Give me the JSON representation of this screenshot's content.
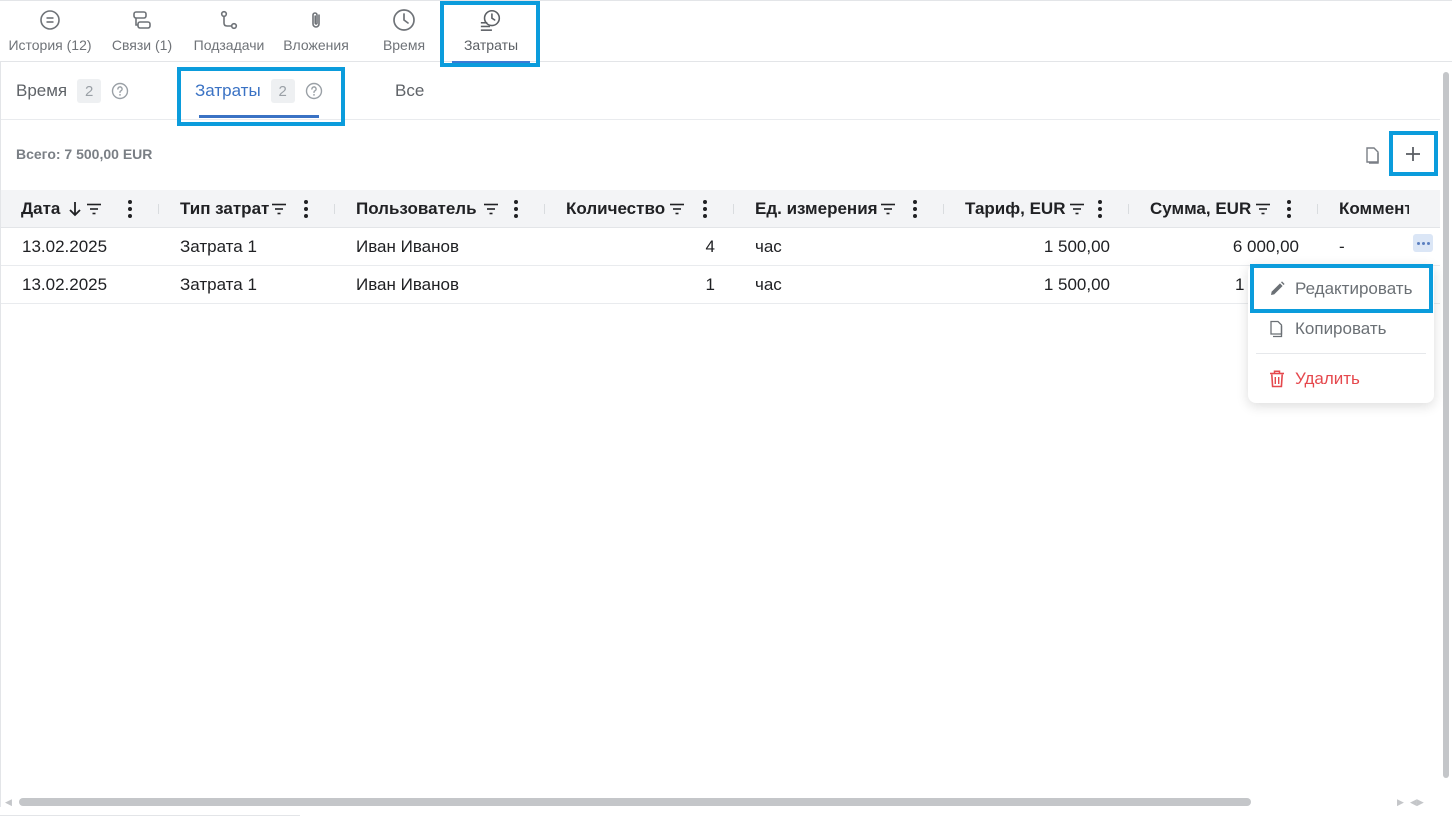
{
  "top_tabs": [
    {
      "label": "История (12)",
      "icon": "history-chat-icon"
    },
    {
      "label": "Связи (1)",
      "icon": "links-icon"
    },
    {
      "label": "Подзадачи",
      "icon": "subtasks-icon"
    },
    {
      "label": "Вложения",
      "icon": "paperclip-icon"
    },
    {
      "label": "Время",
      "icon": "clock-icon"
    },
    {
      "label": "Затраты",
      "icon": "costs-clock-icon",
      "active": true
    }
  ],
  "sub_tabs": [
    {
      "label": "Время",
      "count": "2"
    },
    {
      "label": "Затраты",
      "count": "2",
      "active": true
    },
    {
      "label": "Все"
    }
  ],
  "summary": "Всего: 7 500,00 EUR",
  "table": {
    "columns": [
      "Дата",
      "Тип затрат",
      "Пользователь",
      "Количество",
      "Ед. измерения",
      "Тариф, EUR",
      "Сумма, EUR",
      "Коммент"
    ],
    "rows": [
      [
        "13.02.2025",
        "Затрата 1",
        "Иван Иванов",
        "4",
        "час",
        "1 500,00",
        "6 000,00",
        "-"
      ],
      [
        "13.02.2025",
        "Затрата 1",
        "Иван Иванов",
        "1",
        "час",
        "1 500,00",
        "1",
        ""
      ]
    ]
  },
  "context_menu": {
    "edit": "Редактировать",
    "copy": "Копировать",
    "delete": "Удалить"
  },
  "colors": {
    "accent": "#3a72c4",
    "highlight": "#0b9cdc",
    "danger": "#e5484d"
  }
}
